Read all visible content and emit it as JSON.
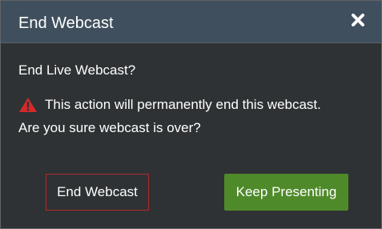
{
  "dialog": {
    "title": "End Webcast",
    "close_icon": "close-icon",
    "question": "End Live Webcast?",
    "warning_icon": "warning-triangle-icon",
    "warning_text": "This action will permanently end this webcast.",
    "confirm_text": "Are you sure webcast is over?",
    "end_button_label": "End Webcast",
    "keep_button_label": "Keep Presenting"
  },
  "colors": {
    "header_bg": "#3f4f5d",
    "body_bg": "#2e3234",
    "danger": "#d42a2a",
    "danger_border": "#b02a2a",
    "primary_green": "#4f8a2a",
    "text": "#ffffff"
  }
}
